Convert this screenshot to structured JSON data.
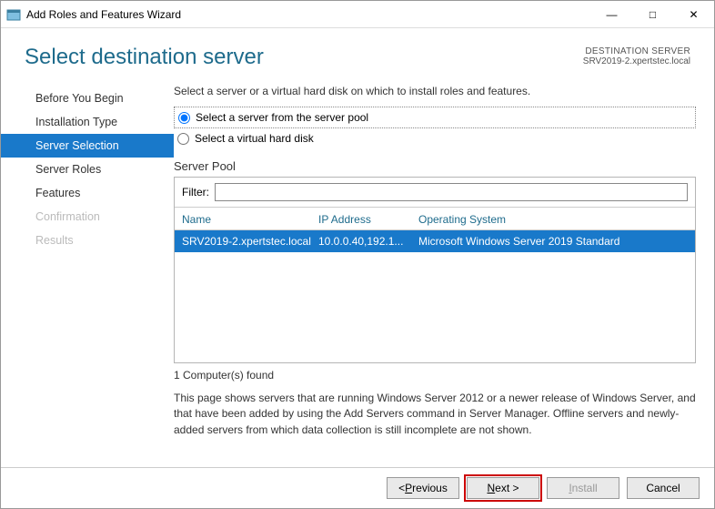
{
  "window": {
    "title": "Add Roles and Features Wizard"
  },
  "header": {
    "page_title": "Select destination server",
    "dest_label": "DESTINATION SERVER",
    "dest_value": "SRV2019-2.xpertstec.local"
  },
  "sidebar": {
    "steps": [
      {
        "label": "Before You Begin",
        "state": "normal"
      },
      {
        "label": "Installation Type",
        "state": "normal"
      },
      {
        "label": "Server Selection",
        "state": "active"
      },
      {
        "label": "Server Roles",
        "state": "normal"
      },
      {
        "label": "Features",
        "state": "normal"
      },
      {
        "label": "Confirmation",
        "state": "disabled"
      },
      {
        "label": "Results",
        "state": "disabled"
      }
    ]
  },
  "main": {
    "intro": "Select a server or a virtual hard disk on which to install roles and features.",
    "radio_pool": "Select a server from the server pool",
    "radio_vhd": "Select a virtual hard disk",
    "selected_radio": "pool",
    "pool_label": "Server Pool",
    "filter_label": "Filter:",
    "filter_value": "",
    "columns": {
      "name": "Name",
      "ip": "IP Address",
      "os": "Operating System"
    },
    "rows": [
      {
        "name": "SRV2019-2.xpertstec.local",
        "ip": "10.0.0.40,192.1...",
        "os": "Microsoft Windows Server 2019 Standard"
      }
    ],
    "found_text": "1 Computer(s) found",
    "note": "This page shows servers that are running Windows Server 2012 or a newer release of Windows Server, and that have been added by using the Add Servers command in Server Manager. Offline servers and newly-added servers from which data collection is still incomplete are not shown."
  },
  "footer": {
    "previous": "Previous",
    "next": "Next >",
    "install": "Install",
    "cancel": "Cancel"
  }
}
